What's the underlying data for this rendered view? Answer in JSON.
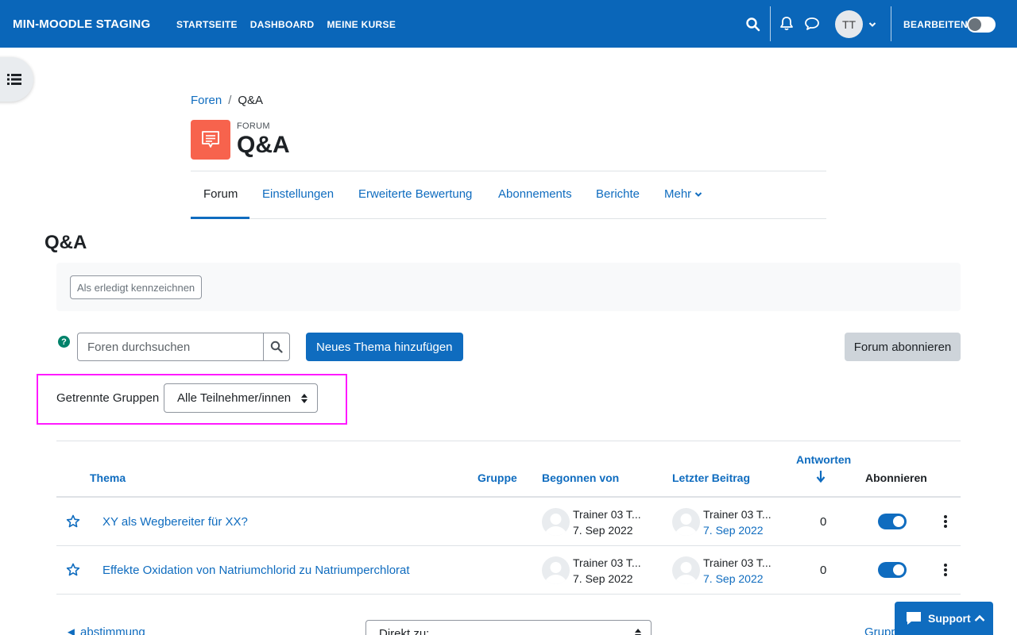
{
  "navbar": {
    "brand": "MIN-MOODLE STAGING",
    "links": [
      "STARTSEITE",
      "DASHBOARD",
      "MEINE KURSE"
    ],
    "avatar_initials": "TT",
    "edit_label": "BEARBEITEN",
    "color": "#0a66b9"
  },
  "breadcrumb": {
    "parent": "Foren",
    "separator": "/",
    "current": "Q&A"
  },
  "module": {
    "type_label": "FORUM",
    "title": "Q&A",
    "icon_color": "#f7634d"
  },
  "tabs": [
    "Forum",
    "Einstellungen",
    "Erweiterte Bewertung",
    "Abonnements",
    "Berichte",
    "Mehr"
  ],
  "page_heading": "Q&A",
  "completion": {
    "mark_done_label": "Als erledigt kennzeichnen"
  },
  "search": {
    "placeholder": "Foren durchsuchen"
  },
  "new_topic_label": "Neues Thema hinzufügen",
  "subscribe_label": "Forum abonnieren",
  "groups": {
    "label": "Getrennte Gruppen",
    "selected": "Alle Teilnehmer/innen"
  },
  "table": {
    "headers": {
      "topic": "Thema",
      "group": "Gruppe",
      "started_by": "Begonnen von",
      "last_post": "Letzter Beitrag",
      "replies": "Antworten",
      "subscribe": "Abonnieren"
    },
    "rows": [
      {
        "topic": "XY als Wegbereiter für XX?",
        "started_by": "Trainer 03 T...",
        "started_date": "7. Sep 2022",
        "last_by": "Trainer 03 T...",
        "last_date": "7. Sep 2022",
        "replies": "0",
        "subscribed": true
      },
      {
        "topic": "Effekte Oxidation von Natriumchlorid zu Natriumperchlorat",
        "started_by": "Trainer 03 T...",
        "started_date": "7. Sep 2022",
        "last_by": "Trainer 03 T...",
        "last_date": "7. Sep 2022",
        "replies": "0",
        "subscribed": true
      }
    ]
  },
  "footer_nav": {
    "prev": "◄ abstimmung",
    "jump_label": "Direkt zu:",
    "next": "Grupp"
  },
  "support_label": "Support"
}
